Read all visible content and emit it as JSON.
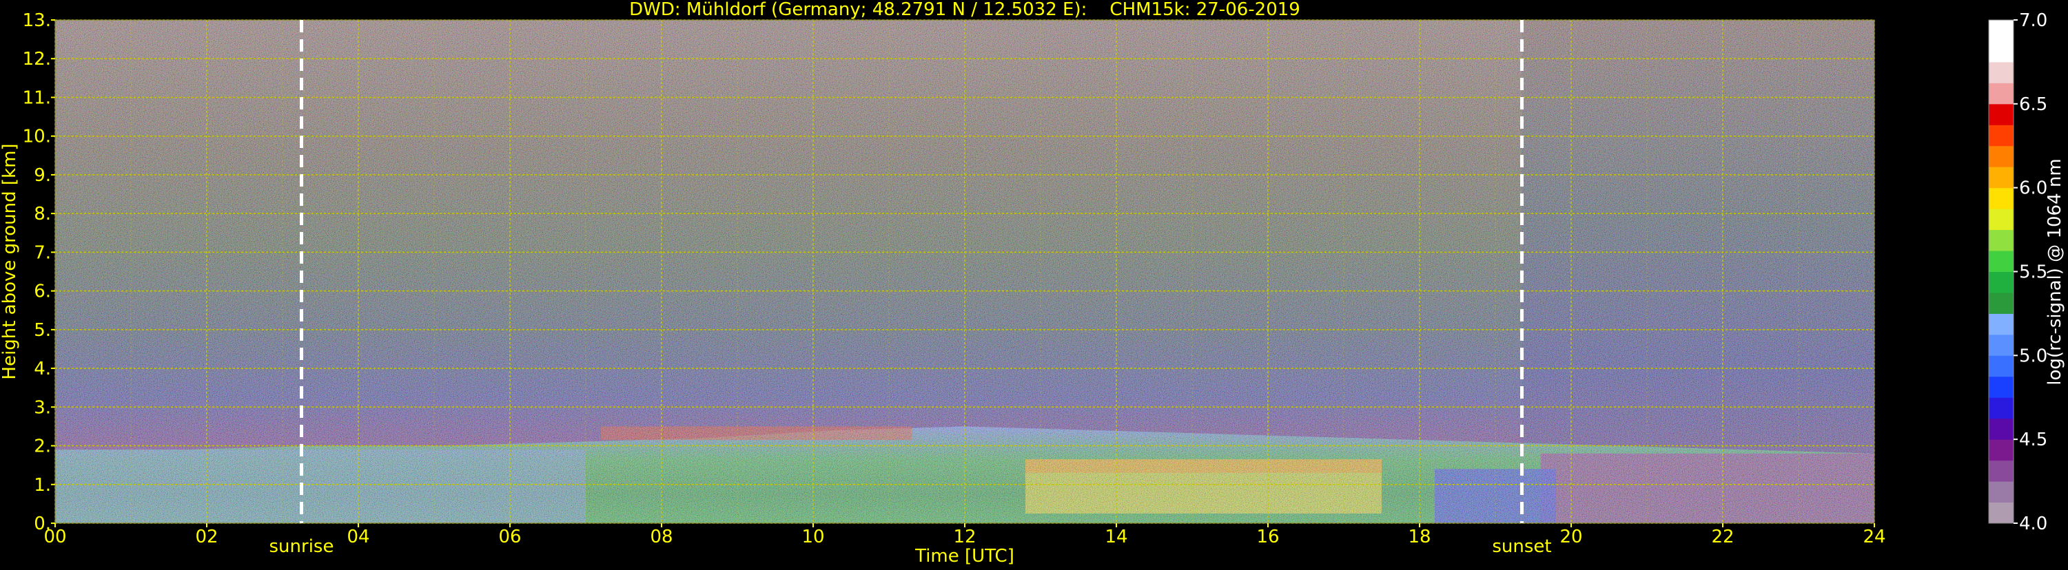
{
  "chart_data": {
    "type": "heatmap",
    "title": "DWD: Mühldorf (Germany; 48.2791 N / 12.5032 E):    CHM15k: 27-06-2019",
    "xlabel": "Time [UTC]",
    "ylabel": "Height above ground [km]",
    "xlim": [
      0,
      24
    ],
    "ylim": [
      0,
      13
    ],
    "x_ticks": [
      "00",
      "02",
      "04",
      "06",
      "08",
      "10",
      "12",
      "14",
      "16",
      "18",
      "20",
      "22",
      "24"
    ],
    "y_ticks": [
      "0.",
      "1.",
      "2.",
      "3.",
      "4.",
      "5.",
      "6.",
      "7.",
      "8.",
      "9.",
      "10.",
      "11.",
      "12.",
      "13."
    ],
    "grid": true,
    "annotations": [
      {
        "label": "sunrise",
        "x": 3.25
      },
      {
        "label": "sunset",
        "x": 19.35
      }
    ],
    "colorbar": {
      "label": "log(rc-signal) @ 1064 nm",
      "range": [
        4.0,
        7.0
      ],
      "ticks": [
        "7.0",
        "6.5",
        "6.0",
        "5.5",
        "5.0",
        "4.5",
        "4.0"
      ]
    },
    "layers": [
      {
        "name": "boundary-layer-aerosol",
        "t_start": 0,
        "t_end": 24,
        "top_km": [
          1.9,
          1.9,
          2.0,
          2.0,
          2.1,
          2.2,
          2.4,
          2.5,
          2.4,
          2.3,
          2.2,
          2.1,
          2.0,
          1.9,
          1.8
        ],
        "signal": 5.5
      },
      {
        "name": "cloud-tops",
        "t_start": 7.2,
        "t_end": 11.3,
        "height_km": 2.3,
        "signal": 6.3
      },
      {
        "name": "dense-aerosol-afternoon",
        "t_start": 12.8,
        "t_end": 17.5,
        "height_km": 1.4,
        "signal": 6.0
      }
    ]
  },
  "colors": {
    "background": "#000000",
    "text": "#ffff00",
    "grid": "#c8c800",
    "marker_line": "#ffffff",
    "colorbar_text": "#ffffff"
  }
}
